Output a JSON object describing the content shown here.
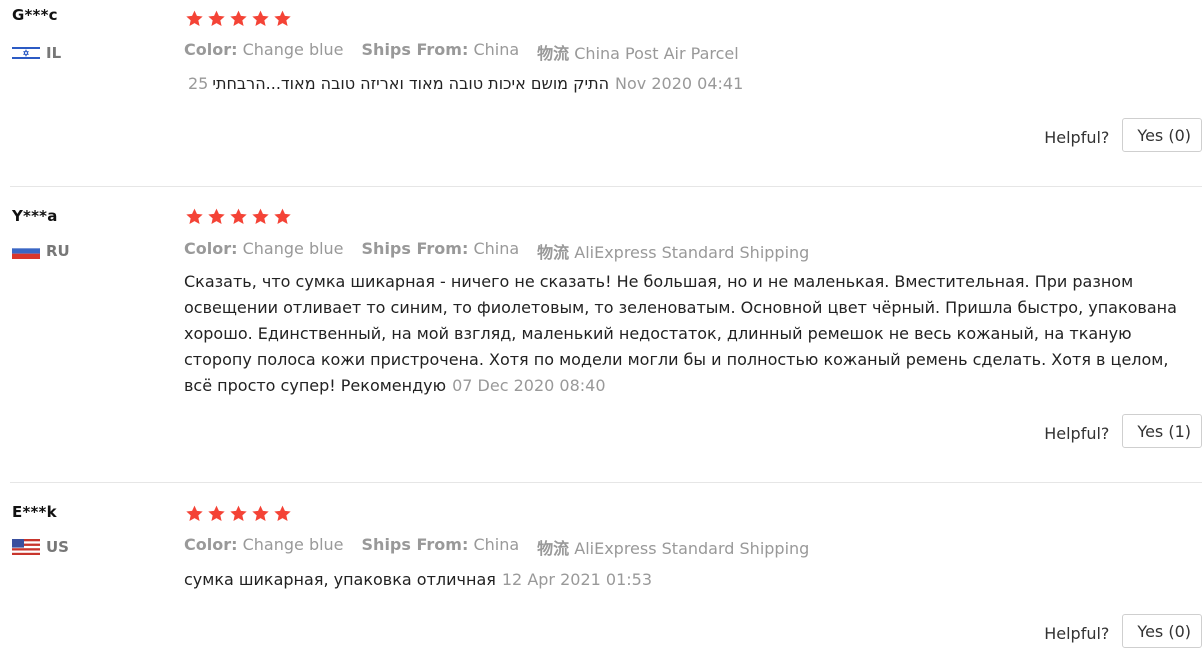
{
  "colors": {
    "star": "#f44336",
    "muted_text": "#999999",
    "divider": "#e6e6e6"
  },
  "labels": {
    "color_key": "Color:",
    "ships_key": "Ships From:",
    "logistics_key": "物流",
    "helpful": "Helpful?"
  },
  "reviews": [
    {
      "user": "G***c",
      "country": "IL",
      "flag_icon": "israel-flag-icon",
      "rating": 5,
      "color": "Change blue",
      "ships_from": "China",
      "logistics": "China Post Air Parcel",
      "lead": "25",
      "text": "התיק מושם איכות טובה מאוד ואריזה טובה מאוד...הרבחתי",
      "date": "Nov 2020 04:41",
      "yes_label": "Yes (0)"
    },
    {
      "user": "Y***a",
      "country": "RU",
      "flag_icon": "russia-flag-icon",
      "rating": 5,
      "color": "Change blue",
      "ships_from": "China",
      "logistics": "AliExpress Standard Shipping",
      "text": "Сказать, что сумка шикарная - ничего не сказать! Не большая, но и не маленькая. Вместительная. При разном освещении отливает то синим, то фиолетовым, то зеленоватым. Основной цвет чёрный. Пришла быстро, упакована хорошо. Единственный, на мой взгляд, маленький недостаток, длинный ремешок не весь кожаный, на тканую сторопу полоса кожи пристрочена. Хотя по модели могли бы и полностью кожаный ремень сделать. Хотя в целом, всё просто супер! Рекомендую",
      "date": "07 Dec 2020 08:40",
      "yes_label": "Yes (1)"
    },
    {
      "user": "E***k",
      "country": "US",
      "flag_icon": "usa-flag-icon",
      "rating": 5,
      "color": "Change blue",
      "ships_from": "China",
      "logistics": "AliExpress Standard Shipping",
      "text": "сумка шикарная, упаковка отличная",
      "date": "12 Apr 2021 01:53",
      "yes_label": "Yes (0)"
    }
  ]
}
